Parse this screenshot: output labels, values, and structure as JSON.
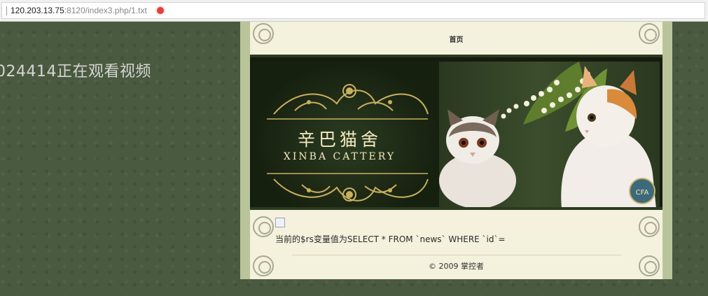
{
  "browser": {
    "url_host": "120.203.13.75",
    "url_rest": ":8120/index3.php/1.txt"
  },
  "overlay": {
    "watermark": "024414正在观看视频"
  },
  "page": {
    "nav_home": "首页",
    "banner_title_cn": "辛巴猫舍",
    "banner_title_en": "XINBA CATTERY",
    "banner_badge": "CFA",
    "query_text": "当前的$rs变量值为SELECT * FROM `news` WHERE `id`=",
    "copyright": "© 2009 掌控者"
  },
  "colors": {
    "background": "#4a5a40",
    "frame": "#b9c49a",
    "content_bg": "#f4f1dc",
    "banner_dark": "#141c10",
    "gold": "#c9b060"
  }
}
